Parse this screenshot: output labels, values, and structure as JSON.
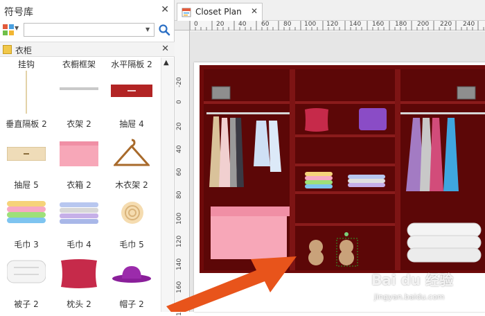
{
  "library": {
    "title": "符号库",
    "close_icon": "close-icon",
    "search": {
      "value": "",
      "placeholder": ""
    },
    "category": {
      "label": "衣柜"
    },
    "shapes": [
      {
        "label": "挂钩"
      },
      {
        "label": "衣橱框架"
      },
      {
        "label": "水平隔板 2"
      },
      {
        "label": "垂直隔板 2"
      },
      {
        "label": "衣架 2"
      },
      {
        "label": "抽屉 4"
      },
      {
        "label": "抽屉 5"
      },
      {
        "label": "衣箱 2"
      },
      {
        "label": "木衣架 2"
      },
      {
        "label": "毛巾 3"
      },
      {
        "label": "毛巾 4"
      },
      {
        "label": "毛巾 5"
      },
      {
        "label": "被子 2"
      },
      {
        "label": "枕头 2"
      },
      {
        "label": "帽子 2"
      }
    ]
  },
  "document": {
    "tab_label": "Closet Plan",
    "ruler_top": [
      "0",
      "20",
      "40",
      "60",
      "80",
      "100",
      "120",
      "140",
      "160",
      "180",
      "200",
      "220",
      "240"
    ],
    "ruler_left": [
      "-20",
      "0",
      "20",
      "40",
      "60",
      "80",
      "100",
      "120",
      "140",
      "160",
      "180"
    ]
  },
  "watermark": {
    "brand": "Bai du 经验",
    "url": "jingyan.baidu.com"
  },
  "colors": {
    "wardrobe": "#6e0a0a",
    "accent_blue": "#2b6fc4",
    "arrow": "#e8541b"
  }
}
